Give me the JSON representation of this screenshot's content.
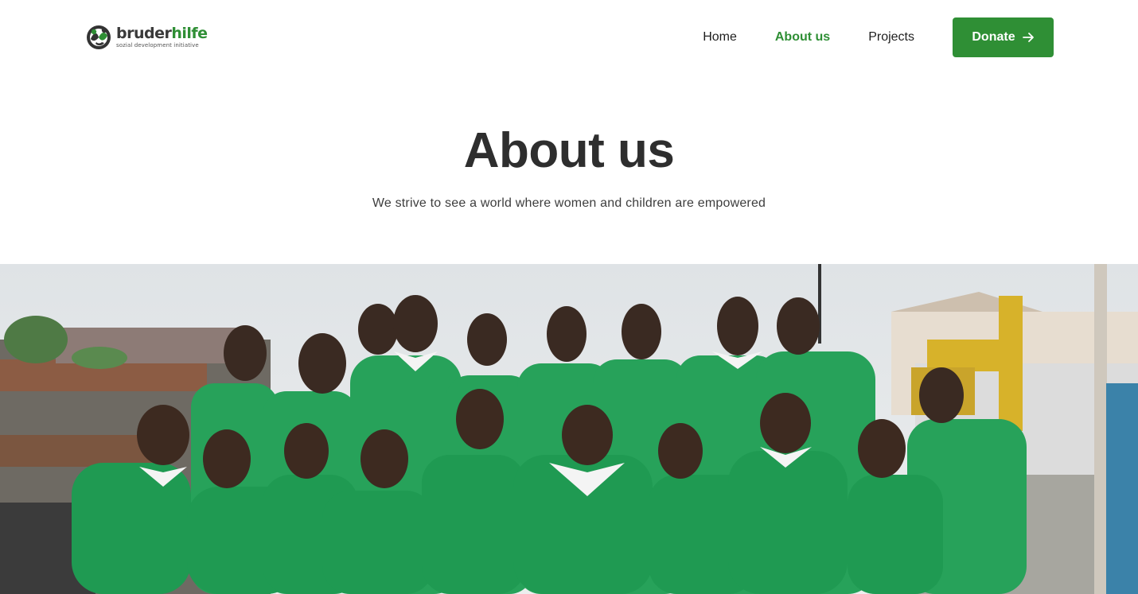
{
  "brand": {
    "name_part1": "bruder",
    "name_part2": "hilfe",
    "tagline": "sozial development initiative"
  },
  "nav": {
    "items": [
      {
        "label": "Home",
        "active": false
      },
      {
        "label": "About us",
        "active": true
      },
      {
        "label": "Projects",
        "active": false
      }
    ],
    "donate_label": "Donate"
  },
  "hero": {
    "title": "About us",
    "subtitle": "We strive to see a world where women and children are empowered"
  },
  "colors": {
    "accent": "#2f8f35",
    "heading": "#2e2e2e",
    "text": "#3d3d3d"
  }
}
